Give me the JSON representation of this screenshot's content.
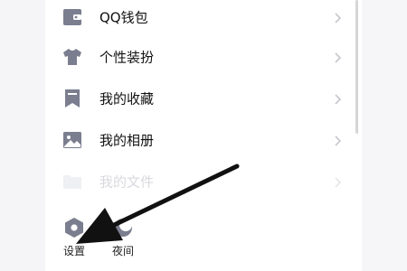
{
  "menu": {
    "items": [
      {
        "label": "QQ钱包",
        "icon": "wallet-icon"
      },
      {
        "label": "个性装扮",
        "icon": "shirt-icon"
      },
      {
        "label": "我的收藏",
        "icon": "bookmark-icon"
      },
      {
        "label": "我的相册",
        "icon": "photo-album-icon"
      },
      {
        "label": "我的文件",
        "icon": "folder-icon"
      }
    ]
  },
  "bottom_bar": {
    "settings_label": "设置",
    "night_label": "夜间"
  },
  "colors": {
    "icon_gray": "#7a7e8f",
    "text": "#111111",
    "faded_text": "#d9d9de",
    "chevron": "#c7c7cc",
    "arrow": "#111111"
  }
}
